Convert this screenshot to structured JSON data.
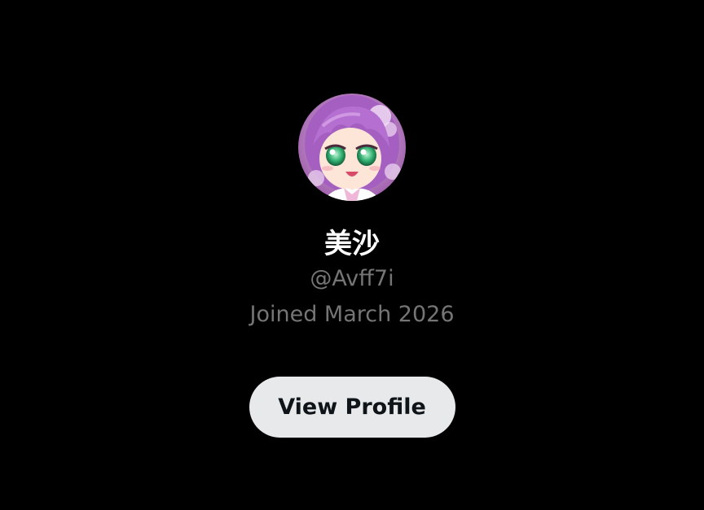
{
  "profile": {
    "avatar_icon": "anime-avatar",
    "display_name": "美沙",
    "handle": "@Avff7i",
    "joined": "Joined March 2026",
    "view_profile_label": "View Profile"
  },
  "colors": {
    "background": "#000000",
    "name_text": "#ffffff",
    "secondary_text": "#757575",
    "button_bg": "#e7e9ea",
    "button_text": "#0f1419"
  }
}
